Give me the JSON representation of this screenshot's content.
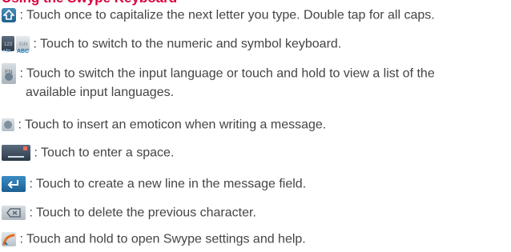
{
  "heading": "Using the Swype Keyboard",
  "items": [
    {
      "icon": "shift-key-icon",
      "text": ": Touch once to capitalize the next letter you type. Double tap for all caps."
    },
    {
      "icon": "symbol-abc-key-icon",
      "key_top_left": "123",
      "key_bottom_left": "+!=",
      "key_top_right": "Edit",
      "key_bottom_right": "ABC",
      "text": ": Touch to switch to the numeric and symbol keyboard."
    },
    {
      "icon": "language-key-icon",
      "key_label": "EN",
      "text": ": Touch to switch the input language or touch and hold to view a list of the",
      "text2": "available input languages."
    },
    {
      "icon": "emoticon-key-icon",
      "text": ": Touch to insert an emoticon when writing a message."
    },
    {
      "icon": "space-key-icon",
      "text": ": Touch to enter a space."
    },
    {
      "icon": "enter-key-icon",
      "text": ": Touch to create a new line in the message field."
    },
    {
      "icon": "delete-key-icon",
      "text": ": Touch to delete the previous character."
    },
    {
      "icon": "swype-key-icon",
      "text": ": Touch and hold to open Swype settings and help."
    }
  ]
}
